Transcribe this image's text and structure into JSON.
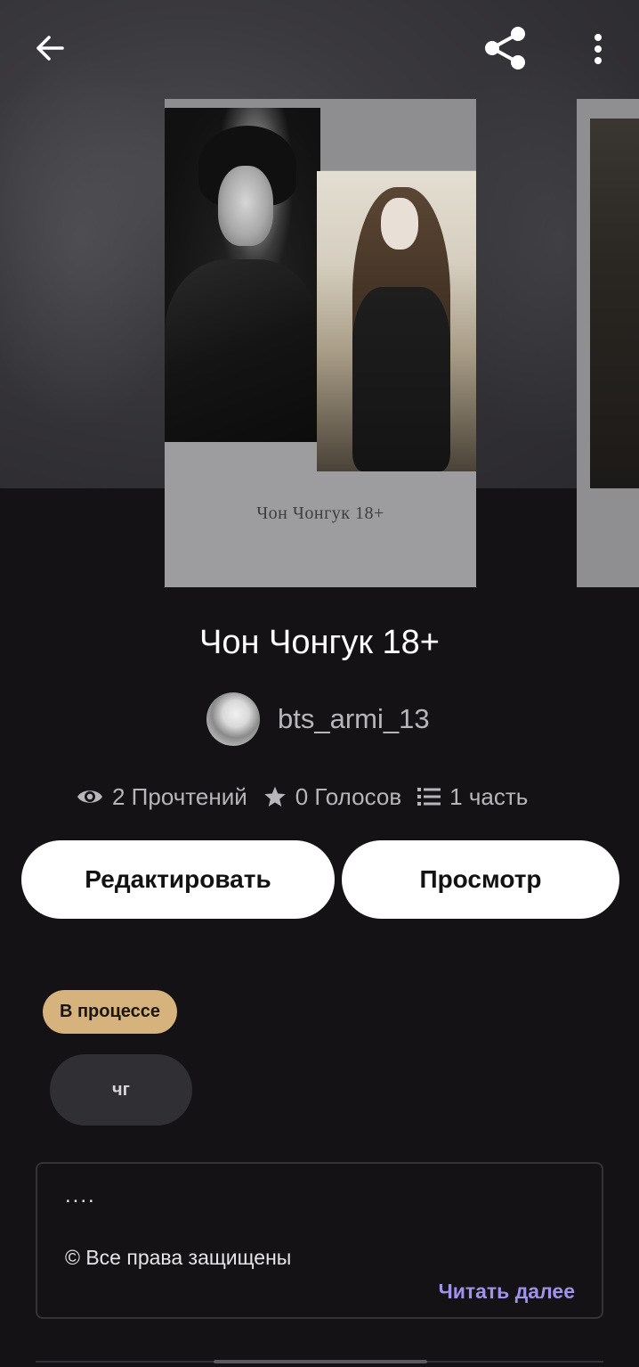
{
  "header": {
    "back_icon": "arrow-left-icon",
    "share_icon": "share-icon",
    "more_icon": "more-vertical-icon"
  },
  "cover": {
    "title_text": "Чон Чонгук 18+"
  },
  "story": {
    "title": "Чон Чонгук 18+",
    "author": "bts_armi_13"
  },
  "stats": {
    "reads": "2 Прочтений",
    "votes": "0 Голосов",
    "parts": "1 часть"
  },
  "actions": {
    "edit_label": "Редактировать",
    "view_label": "Просмотр"
  },
  "status": {
    "label": "В процессе",
    "color": "#d6b27c"
  },
  "tags": [
    "чг"
  ],
  "description": {
    "line1": "....",
    "line2": "© Все права защищены",
    "read_more": "Читать далее",
    "read_more_color": "#9f93e8"
  }
}
